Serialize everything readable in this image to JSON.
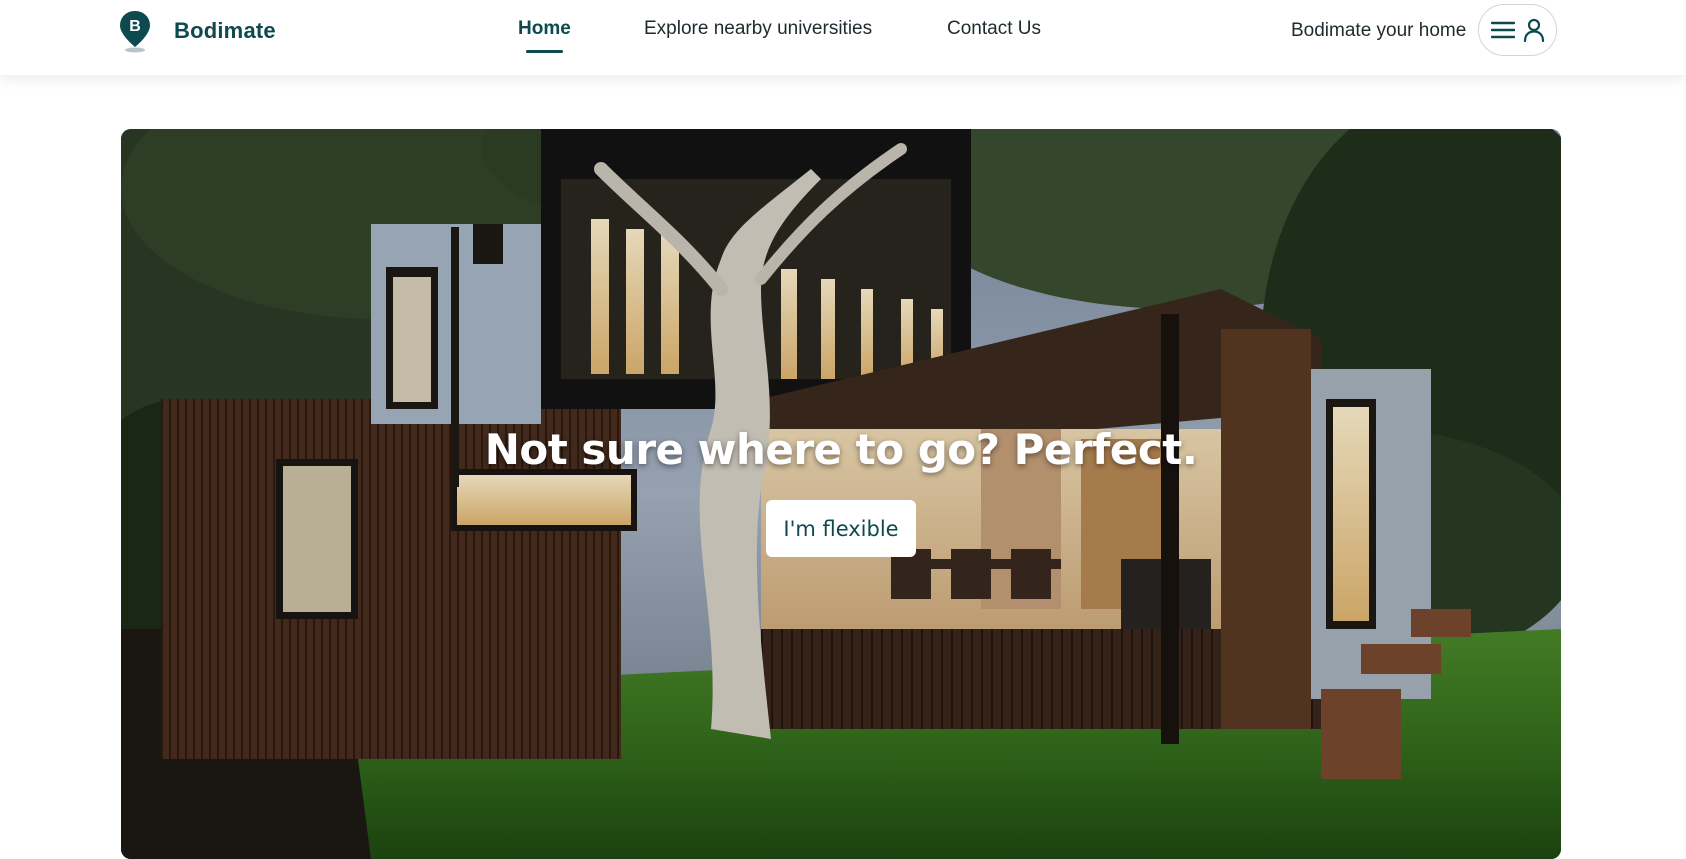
{
  "brand": {
    "name": "Bodimate",
    "logo_letter": "B",
    "icon": "map-pin-logo-icon"
  },
  "nav": {
    "items": [
      {
        "label": "Home",
        "active": true
      },
      {
        "label": "Explore nearby universities",
        "active": false
      },
      {
        "label": "Contact Us",
        "active": false
      }
    ]
  },
  "header_right": {
    "host_link": "Bodimate your home",
    "menu_icon": "hamburger-icon",
    "user_icon": "user-icon"
  },
  "hero": {
    "title": "Not sure where to go? Perfect.",
    "button_label": "I'm flexible",
    "image": "modern-house-at-dusk"
  },
  "colors": {
    "brand": "#0d4a4f",
    "text": "#1f2a2e",
    "white": "#ffffff"
  }
}
